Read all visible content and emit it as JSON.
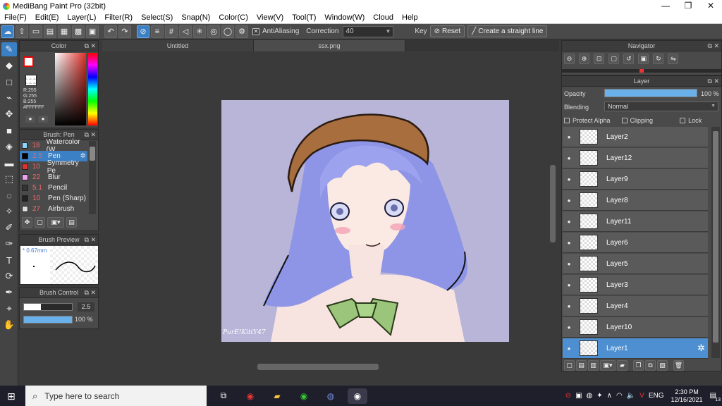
{
  "window": {
    "title": "MediBang Paint Pro (32bit)",
    "minimize": "—",
    "maximize": "❐",
    "close": "✕"
  },
  "menu": [
    "File(F)",
    "Edit(E)",
    "Layer(L)",
    "Filter(R)",
    "Select(S)",
    "Snap(N)",
    "Color(C)",
    "View(V)",
    "Tool(T)",
    "Window(W)",
    "Cloud",
    "Help"
  ],
  "toolbar": {
    "antialiasing_label": "AntiAliasing",
    "correction_label": "Correction",
    "correction_value": "40",
    "key_label": "Key",
    "reset_label": "Reset",
    "straight_line_label": "Create a straight line"
  },
  "color_panel": {
    "title": "Color",
    "r": "R:255",
    "g": "G:255",
    "b": "B:255",
    "hex": "#FFFFFF"
  },
  "brush_panel": {
    "title": "Brush: Pen",
    "items": [
      {
        "size": "18",
        "name": "Watercolor (W",
        "color": "#8fd4ff"
      },
      {
        "size": "2.5",
        "name": "Pen",
        "color": "#000000"
      },
      {
        "size": "10",
        "name": "Symmetry Pe",
        "color": "#e03030"
      },
      {
        "size": "22",
        "name": "Blur",
        "color": "#f0a0f0"
      },
      {
        "size": "5.1",
        "name": "Pencil",
        "color": "#333333"
      },
      {
        "size": "10",
        "name": "Pen (Sharp)",
        "color": "#222222"
      },
      {
        "size": "27",
        "name": "Airbrush",
        "color": "#dddddd"
      }
    ]
  },
  "brush_preview": {
    "title": "Brush Preview",
    "size": "* 0.67mm"
  },
  "brush_control": {
    "title": "Brush Control",
    "size_value": "2.5",
    "opacity_value": "100 %",
    "size_fraction": 0.35,
    "opacity_fraction": 1.0
  },
  "tabs": [
    "Untitled",
    "ssx.png"
  ],
  "canvas": {
    "signature": "PurE!KittY47"
  },
  "navigator": {
    "title": "Navigator"
  },
  "layer_panel": {
    "title": "Layer",
    "opacity_label": "Opacity",
    "opacity_value": "100 %",
    "blending_label": "Blending",
    "blending_value": "Normal",
    "protect_alpha": "Protect Alpha",
    "clipping": "Clipping",
    "lock": "Lock",
    "layers": [
      "Layer2",
      "Layer12",
      "Layer9",
      "Layer8",
      "Layer11",
      "Layer6",
      "Layer5",
      "Layer3",
      "Layer4",
      "Layer10",
      "Layer1"
    ],
    "active_layer": "Layer1"
  },
  "taskbar": {
    "search_placeholder": "Type here to search",
    "lang": "ENG",
    "time": "2:30 PM",
    "date": "12/16/2021",
    "notif_count": "13"
  }
}
